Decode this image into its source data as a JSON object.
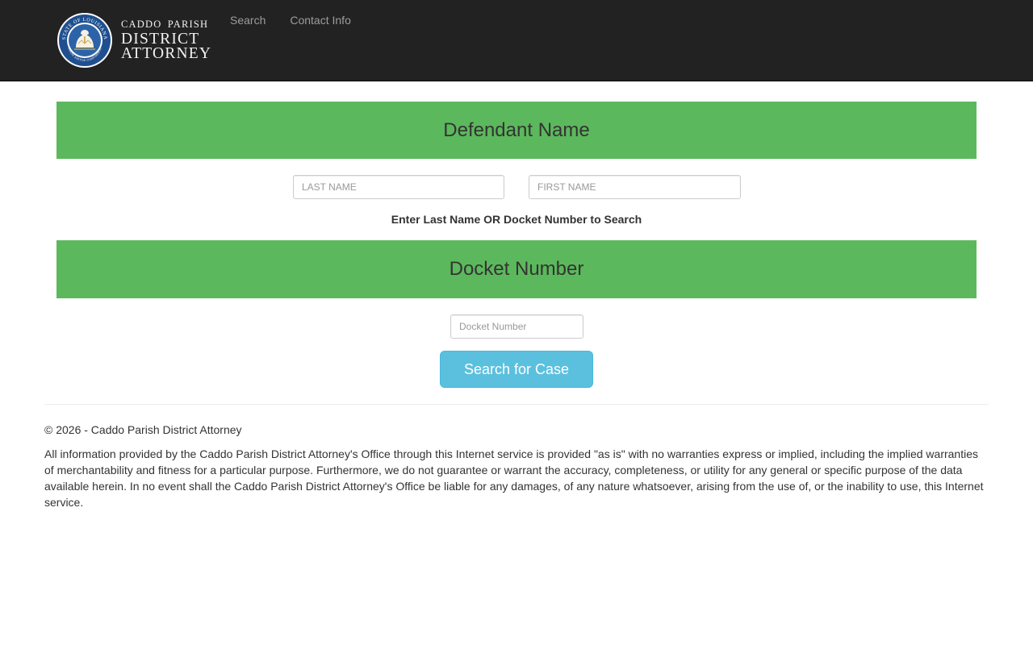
{
  "brand": {
    "line1": "CADDO PARISH",
    "line2": "DISTRICT",
    "line3": "ATTORNEY",
    "seal_text": "STATE OF LOUISIANA",
    "seal_motto": "UNION JUSTICE CONFIDENCE",
    "seal_icon": "pelican-seal-icon"
  },
  "nav": {
    "items": [
      {
        "label": "Search"
      },
      {
        "label": "Contact Info"
      }
    ]
  },
  "defendant": {
    "header": "Defendant Name",
    "last_name_placeholder": "LAST NAME",
    "first_name_placeholder": "FIRST NAME",
    "last_name_value": "",
    "first_name_value": ""
  },
  "hint": "Enter Last Name OR Docket Number to Search",
  "docket": {
    "header": "Docket Number",
    "placeholder": "Docket Number",
    "value": ""
  },
  "search_button": "Search for Case",
  "footer": {
    "copyright": "© 2026 - Caddo Parish District Attorney",
    "disclaimer": "All information provided by the Caddo Parish District Attorney's Office through this Internet service is provided \"as is\" with no warranties express or implied, including the implied warranties of merchantability and fitness for a particular purpose. Furthermore, we do not guarantee or warrant the accuracy, completeness, or utility for any general or specific purpose of the data available herein. In no event shall the Caddo Parish District Attorney's Office be liable for any damages, of any nature whatsoever, arising from the use of, or the inability to use, this Internet service."
  },
  "colors": {
    "navbar": "#222222",
    "section_header": "#5cb85c",
    "button": "#5bc0de",
    "nav_link": "#9d9d9d"
  }
}
